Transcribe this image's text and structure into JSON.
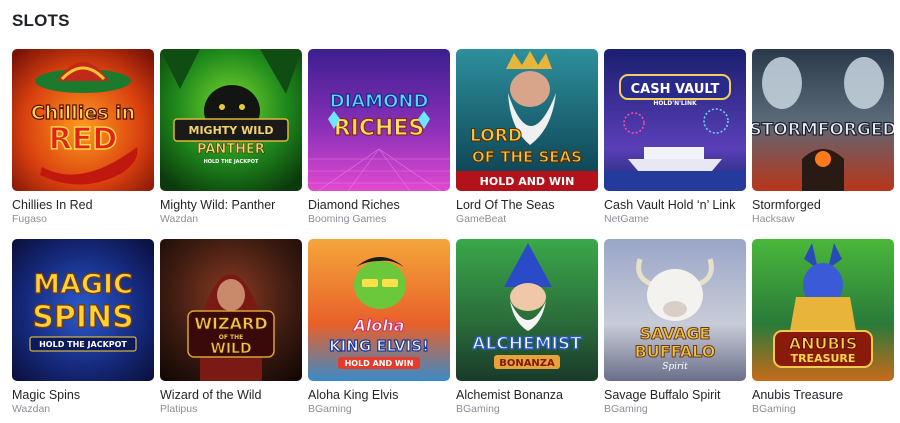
{
  "section": {
    "title": "SLOTS"
  },
  "games": [
    {
      "name": "Chillies In Red",
      "provider": "Fugaso",
      "art": {
        "title_line1": "Chillies in",
        "title_line2": "RED"
      }
    },
    {
      "name": "Mighty Wild: Panther",
      "provider": "Wazdan",
      "art": {
        "title_line1": "MIGHTY WILD",
        "title_line2": "PANTHER",
        "tagline": "HOLD THE JACKPOT"
      }
    },
    {
      "name": "Diamond Riches",
      "provider": "Booming Games",
      "art": {
        "title_line1": "DIAMOND",
        "title_line2": "RICHES"
      }
    },
    {
      "name": "Lord Of The Seas",
      "provider": "GameBeat",
      "art": {
        "title_line1": "LORD",
        "title_line2": "OF THE SEAS",
        "banner": "HOLD AND WIN"
      }
    },
    {
      "name": "Cash Vault Hold ‘n’ Link",
      "provider": "NetGame",
      "art": {
        "title_line1": "CASH VAULT",
        "tagline": "HOLD'N'LINK"
      }
    },
    {
      "name": "Stormforged",
      "provider": "Hacksaw",
      "art": {
        "title_line1": "STORMFORGED"
      }
    },
    {
      "name": "Magic Spins",
      "provider": "Wazdan",
      "art": {
        "title_line1": "MAGIC",
        "title_line2": "SPINS",
        "tagline": "HOLD THE JACKPOT"
      }
    },
    {
      "name": "Wizard of the Wild",
      "provider": "Platipus",
      "art": {
        "title_line1": "WIZARD",
        "title_line2": "OF THE",
        "title_line3": "WILD"
      }
    },
    {
      "name": "Aloha King Elvis",
      "provider": "BGaming",
      "art": {
        "title_line1": "Aloha",
        "title_line2": "KING ELVIS!",
        "banner": "HOLD AND WIN"
      }
    },
    {
      "name": "Alchemist Bonanza",
      "provider": "BGaming",
      "art": {
        "title_line1": "ALCHEMIST",
        "title_line2": "BONANZA"
      }
    },
    {
      "name": "Savage Buffalo Spirit",
      "provider": "BGaming",
      "art": {
        "title_line1": "SAVAGE",
        "title_line2": "BUFFALO",
        "tagline": "Spirit"
      }
    },
    {
      "name": "Anubis Treasure",
      "provider": "BGaming",
      "art": {
        "title_line1": "ANUBIS",
        "title_line2": "TREASURE"
      }
    }
  ]
}
